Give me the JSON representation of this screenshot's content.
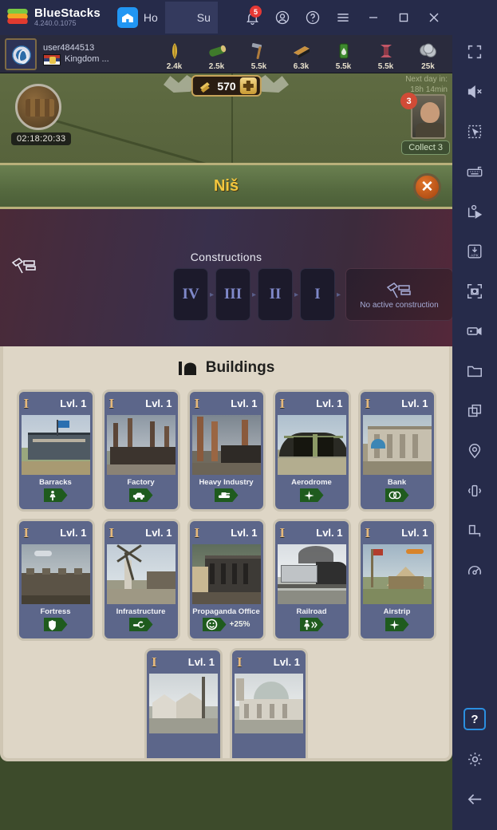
{
  "titlebar": {
    "app_name": "BlueStacks",
    "version": "4.240.0.1075",
    "tabs": [
      {
        "label": "Ho",
        "icon": "home-icon",
        "active": false
      },
      {
        "label": "Su",
        "icon": "game-app-icon",
        "active": true
      }
    ],
    "notification_count": "5",
    "icons": [
      "bell-icon",
      "account-icon",
      "help-icon",
      "menu-icon",
      "minimize-icon",
      "maximize-icon",
      "close-icon"
    ]
  },
  "game": {
    "account": {
      "username": "user4844513",
      "kingdom": "Kingdom ..."
    },
    "resources": [
      {
        "name": "grain-icon",
        "value": "2.4k"
      },
      {
        "name": "wood-icon",
        "value": "2.5k"
      },
      {
        "name": "tools-icon",
        "value": "5.5k"
      },
      {
        "name": "coal-icon",
        "value": "6.3k"
      },
      {
        "name": "oil-icon",
        "value": "5.5k"
      },
      {
        "name": "steel-icon",
        "value": "5.5k"
      },
      {
        "name": "coins-icon",
        "value": "25k"
      }
    ],
    "gold": {
      "amount": "570",
      "add_label": "+"
    },
    "map": {
      "crate_timer": "02:18:20:33",
      "next_day_line1": "Next day in:",
      "next_day_line2": "18h 14min",
      "advisor_badge": "3",
      "collect_label": "Collect 3"
    },
    "city_panel": {
      "title": "Niš",
      "close_label": "✕",
      "constructions": {
        "label": "Constructions",
        "slots": [
          "IV",
          "III",
          "II",
          "I"
        ],
        "separator": "▸",
        "active_label": "No active construction"
      },
      "buildings_section": {
        "title": "Buildings",
        "cards": [
          {
            "level_roman": "I",
            "level_label": "Lvl. 1",
            "name": "Barracks",
            "badge_icon": "infantry-icon",
            "badge_value": ""
          },
          {
            "level_roman": "I",
            "level_label": "Lvl. 1",
            "name": "Factory",
            "badge_icon": "vehicle-icon",
            "badge_value": ""
          },
          {
            "level_roman": "I",
            "level_label": "Lvl. 1",
            "name": "Heavy Industry",
            "badge_icon": "tank-icon",
            "badge_value": ""
          },
          {
            "level_roman": "I",
            "level_label": "Lvl. 1",
            "name": "Aerodrome",
            "badge_icon": "plane-icon",
            "badge_value": ""
          },
          {
            "level_roman": "I",
            "level_label": "Lvl. 1",
            "name": "Bank",
            "badge_icon": "coins-icon",
            "badge_value": ""
          },
          {
            "level_roman": "I",
            "level_label": "Lvl. 1",
            "name": "Fortress",
            "badge_icon": "shield-icon",
            "badge_value": ""
          },
          {
            "level_roman": "I",
            "level_label": "Lvl. 1",
            "name": "Infrastructure",
            "badge_icon": "wrench-icon",
            "badge_value": ""
          },
          {
            "level_roman": "I",
            "level_label": "Lvl. 1",
            "name": "Propaganda Office",
            "badge_icon": "morale-icon",
            "badge_value": "+25%"
          },
          {
            "level_roman": "I",
            "level_label": "Lvl. 1",
            "name": "Railroad",
            "badge_icon": "movement-icon",
            "badge_value": ""
          },
          {
            "level_roman": "I",
            "level_label": "Lvl. 1",
            "name": "Airstrip",
            "badge_icon": "plane-icon",
            "badge_value": ""
          },
          {
            "level_roman": "I",
            "level_label": "Lvl. 1",
            "name": "",
            "badge_icon": "",
            "badge_value": ""
          },
          {
            "level_roman": "I",
            "level_label": "Lvl. 1",
            "name": "",
            "badge_icon": "",
            "badge_value": ""
          }
        ]
      }
    }
  },
  "sidebar": {
    "items": [
      {
        "name": "fullscreen-icon"
      },
      {
        "name": "mute-icon"
      },
      {
        "name": "multi-select-icon"
      },
      {
        "name": "keyboard-controls-icon"
      },
      {
        "name": "macro-recorder-icon"
      },
      {
        "name": "install-apk-icon"
      },
      {
        "name": "screenshot-icon"
      },
      {
        "name": "screen-record-icon"
      },
      {
        "name": "media-manager-icon"
      },
      {
        "name": "multi-instance-icon"
      },
      {
        "name": "location-icon"
      },
      {
        "name": "shake-icon"
      },
      {
        "name": "rotate-icon"
      },
      {
        "name": "gyroscope-icon"
      }
    ],
    "bottom_items": [
      {
        "name": "help-icon",
        "label": "?",
        "selected": true
      },
      {
        "name": "settings-gear-icon"
      },
      {
        "name": "back-arrow-icon"
      }
    ]
  }
}
